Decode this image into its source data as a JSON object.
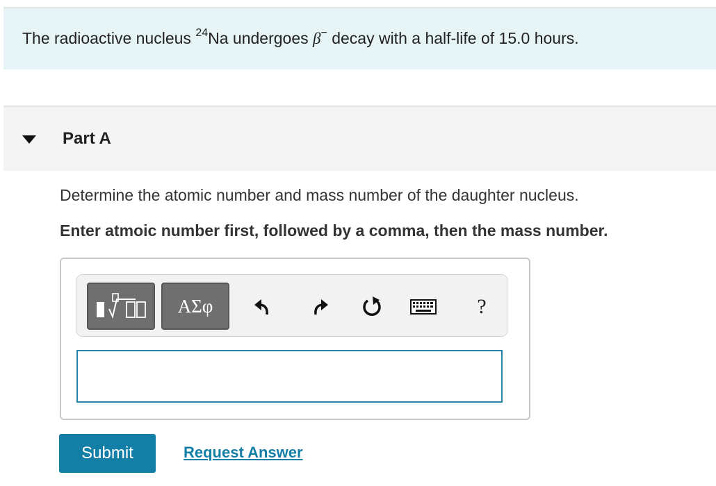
{
  "intro": {
    "prefix": "The radioactive nucleus ",
    "mass_superscript": "24",
    "element": "Na",
    "middle": " undergoes ",
    "beta_symbol": "β",
    "beta_charge": "−",
    "suffix": " decay with a half-life of 15.0 hours."
  },
  "part": {
    "title": "Part A",
    "icon": "caret-down-icon",
    "question": "Determine the atomic number and mass number of the daughter nucleus.",
    "instruction": "Enter atmoic number first, followed by a comma, then the mass number."
  },
  "toolbar": {
    "greek_label": "ΑΣφ",
    "help_label": "?",
    "icons": [
      "templates-icon",
      "undo-icon",
      "redo-icon",
      "reset-icon",
      "keyboard-icon"
    ]
  },
  "answer": {
    "value": "",
    "placeholder": ""
  },
  "actions": {
    "submit_label": "Submit",
    "request_label": "Request Answer"
  },
  "colors": {
    "accent": "#137ea6",
    "intro_bg": "#e6f4f5",
    "input_border": "#2a86a9",
    "toolbar_button": "#6f6f6f"
  }
}
